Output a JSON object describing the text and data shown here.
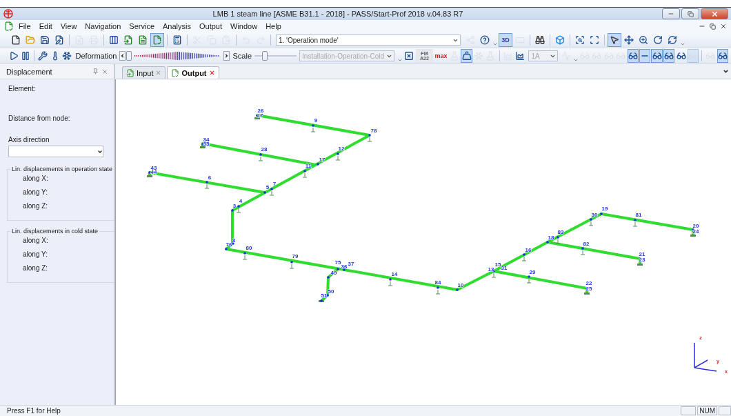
{
  "window": {
    "title": "LMB 1 steam line [ASME B31.1 - 2018] - PASS/Start-Prof 2018 v.04.83 R7"
  },
  "menu": [
    "File",
    "Edit",
    "View",
    "Navigation",
    "Service",
    "Analysis",
    "Output",
    "Window",
    "Help"
  ],
  "toolbars": [
    {
      "items": [
        {
          "kind": "icon",
          "pressed": false,
          "disabled": false
        },
        {
          "kind": "icon",
          "pressed": false,
          "disabled": false
        },
        {
          "kind": "icon",
          "pressed": false,
          "disabled": false
        },
        {
          "kind": "icon",
          "pressed": false,
          "disabled": false
        },
        {
          "kind": "separator"
        },
        {
          "kind": "icon",
          "pressed": false,
          "disabled": true
        },
        {
          "kind": "icon",
          "pressed": false,
          "disabled": true
        },
        {
          "kind": "separator"
        },
        {
          "kind": "icon",
          "pressed": false,
          "disabled": false
        },
        {
          "kind": "icon",
          "pressed": false,
          "disabled": false
        },
        {
          "kind": "icon",
          "pressed": false,
          "disabled": false
        },
        {
          "kind": "icon",
          "pressed": true,
          "disabled": false
        },
        {
          "kind": "separator"
        },
        {
          "kind": "icon",
          "pressed": false,
          "disabled": false
        },
        {
          "kind": "separator"
        },
        {
          "kind": "icon",
          "pressed": false,
          "disabled": true
        },
        {
          "kind": "icon",
          "pressed": false,
          "disabled": true
        },
        {
          "kind": "icon",
          "pressed": false,
          "disabled": true
        },
        {
          "kind": "separator"
        },
        {
          "kind": "icon",
          "pressed": false,
          "disabled": true
        },
        {
          "kind": "icon",
          "pressed": false,
          "disabled": true
        },
        {
          "kind": "separator"
        },
        {
          "kind": "combo",
          "value": "1. 'Operation mode'",
          "disabled": false
        },
        {
          "kind": "icon",
          "pressed": false,
          "disabled": true
        },
        {
          "kind": "icon",
          "pressed": false,
          "disabled": false
        },
        {
          "kind": "grip"
        },
        {
          "kind": "text-icon",
          "label": "3D",
          "pressed": true,
          "disabled": false
        },
        {
          "kind": "icon",
          "pressed": false,
          "disabled": true
        },
        {
          "kind": "separator"
        },
        {
          "kind": "icon",
          "pressed": false,
          "disabled": false
        },
        {
          "kind": "separator"
        },
        {
          "kind": "icon",
          "pressed": false,
          "disabled": false
        },
        {
          "kind": "separator"
        },
        {
          "kind": "icon",
          "pressed": false,
          "disabled": false
        },
        {
          "kind": "icon",
          "pressed": false,
          "disabled": false
        },
        {
          "kind": "separator"
        },
        {
          "kind": "icon",
          "pressed": true,
          "disabled": false
        },
        {
          "kind": "icon",
          "pressed": false,
          "disabled": false
        },
        {
          "kind": "icon",
          "pressed": false,
          "disabled": false
        },
        {
          "kind": "icon",
          "pressed": false,
          "disabled": false
        },
        {
          "kind": "icon",
          "pressed": false,
          "disabled": false
        },
        {
          "kind": "grip"
        }
      ]
    },
    {
      "items": [
        {
          "kind": "icon",
          "pressed": false,
          "disabled": false
        },
        {
          "kind": "icon",
          "pressed": false,
          "disabled": false
        },
        {
          "kind": "separator"
        },
        {
          "kind": "icon",
          "pressed": false,
          "disabled": false
        },
        {
          "kind": "icon",
          "pressed": false,
          "disabled": false
        },
        {
          "kind": "icon",
          "pressed": false,
          "disabled": false
        },
        {
          "kind": "label",
          "text": "Deformation"
        },
        {
          "kind": "wave-slider",
          "level": 0
        },
        {
          "kind": "label",
          "text": "Scale"
        },
        {
          "kind": "slider",
          "level": 0.25
        },
        {
          "kind": "combo",
          "value": "Installation-Operation-Cold",
          "disabled": true
        },
        {
          "kind": "grip"
        },
        {
          "kind": "icon",
          "pressed": false,
          "disabled": false
        },
        {
          "kind": "text-icon",
          "label": "FM A22",
          "pressed": false,
          "disabled": true
        },
        {
          "kind": "text-icon",
          "label": "max",
          "pressed": false,
          "disabled": false
        },
        {
          "kind": "icon",
          "pressed": false,
          "disabled": true
        },
        {
          "kind": "icon",
          "pressed": true,
          "disabled": false
        },
        {
          "kind": "icon",
          "pressed": false,
          "disabled": true
        },
        {
          "kind": "icon",
          "pressed": false,
          "disabled": true
        },
        {
          "kind": "separator"
        },
        {
          "kind": "icon",
          "pressed": false,
          "disabled": true
        },
        {
          "kind": "icon",
          "pressed": false,
          "disabled": false
        },
        {
          "kind": "combo",
          "value": "1A",
          "disabled": true
        },
        {
          "kind": "icon",
          "pressed": false,
          "disabled": true
        },
        {
          "kind": "grip"
        },
        {
          "kind": "icon",
          "pressed": false,
          "disabled": true
        },
        {
          "kind": "icon",
          "pressed": false,
          "disabled": true
        },
        {
          "kind": "icon",
          "pressed": false,
          "disabled": true
        },
        {
          "kind": "icon",
          "pressed": false,
          "disabled": true
        },
        {
          "kind": "icon",
          "pressed": true,
          "disabled": false
        },
        {
          "kind": "icon",
          "pressed": true,
          "disabled": false
        },
        {
          "kind": "icon",
          "pressed": true,
          "disabled": false
        },
        {
          "kind": "icon",
          "pressed": true,
          "disabled": false
        },
        {
          "kind": "icon",
          "pressed": false,
          "disabled": false
        },
        {
          "kind": "icon",
          "pressed": true,
          "disabled": true
        },
        {
          "kind": "separator"
        },
        {
          "kind": "icon",
          "pressed": false,
          "disabled": true
        },
        {
          "kind": "icon",
          "pressed": true,
          "disabled": false
        }
      ]
    }
  ],
  "panel": {
    "title": "Displacement",
    "fields": [
      "Element:",
      "Distance from node:"
    ],
    "axis_label": "Axis direction",
    "groups": [
      {
        "title": "Lin. displacements in operation state",
        "rows": [
          "along X:",
          "along Y:",
          "along Z:"
        ]
      },
      {
        "title": "Lin. displacements in cold state",
        "rows": [
          "along X:",
          "along Y:",
          "along Z:"
        ]
      }
    ]
  },
  "tabs": [
    {
      "label": "Input",
      "selected": false
    },
    {
      "label": "Output",
      "selected": true
    }
  ],
  "nodes": [
    {
      "label": "26"
    },
    {
      "label": "27"
    },
    {
      "label": "9"
    },
    {
      "label": "78"
    },
    {
      "label": "34"
    },
    {
      "label": "35"
    },
    {
      "label": "28"
    },
    {
      "label": "12"
    },
    {
      "label": "17"
    },
    {
      "label": "11"
    },
    {
      "label": "43"
    },
    {
      "label": "44"
    },
    {
      "label": "6"
    },
    {
      "label": "5"
    },
    {
      "label": "7"
    },
    {
      "label": "4"
    },
    {
      "label": "3"
    },
    {
      "label": "8"
    },
    {
      "label": "76"
    },
    {
      "label": "80"
    },
    {
      "label": "79"
    },
    {
      "label": "75"
    },
    {
      "label": "36"
    },
    {
      "label": "37"
    },
    {
      "label": "49"
    },
    {
      "label": "50"
    },
    {
      "label": "51"
    },
    {
      "label": "14"
    },
    {
      "label": "84"
    },
    {
      "label": "10"
    },
    {
      "label": "13"
    },
    {
      "label": "15"
    },
    {
      "label": "31"
    },
    {
      "label": "29"
    },
    {
      "label": "22"
    },
    {
      "label": "25"
    },
    {
      "label": "16"
    },
    {
      "label": "18"
    },
    {
      "label": "83"
    },
    {
      "label": "82"
    },
    {
      "label": "21"
    },
    {
      "label": "23"
    },
    {
      "label": "30"
    },
    {
      "label": "19"
    },
    {
      "label": "81"
    },
    {
      "label": "20"
    },
    {
      "label": "24"
    }
  ],
  "axes": [
    "z",
    "y",
    "x"
  ],
  "status_bar": {
    "text": "Press F1 for Help",
    "indicators": [
      "NUM"
    ]
  }
}
